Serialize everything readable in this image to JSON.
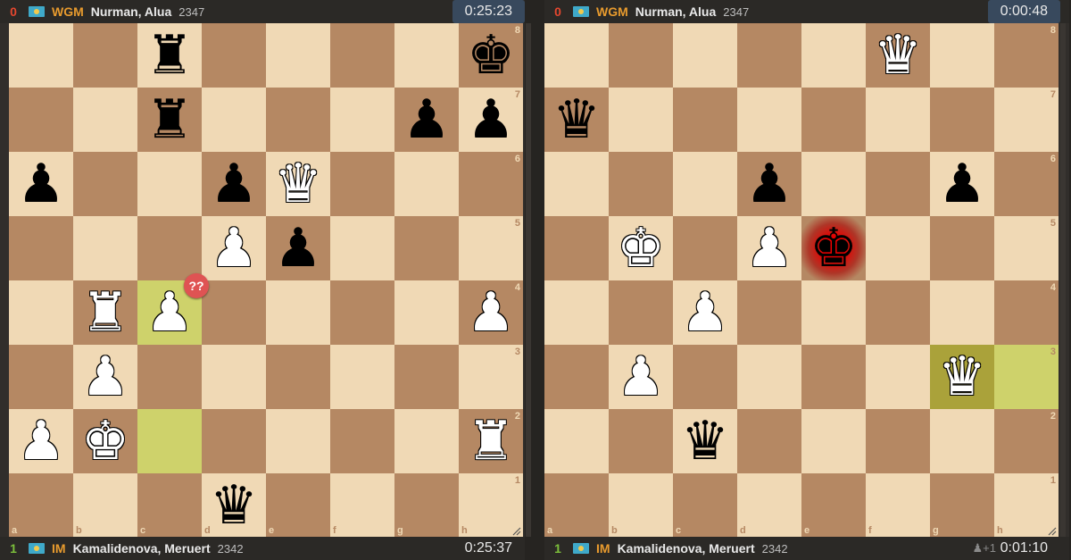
{
  "boards": [
    {
      "top": {
        "score": "0",
        "title": "WGM",
        "name": "Nurman, Alua",
        "rating": "2347",
        "clock": "0:25:23",
        "clock_active": true
      },
      "bottom": {
        "score": "1",
        "title": "IM",
        "name": "Kamalidenova, Meruert",
        "rating": "2342",
        "clock": "0:25:37",
        "clock_active": false,
        "extra": ""
      },
      "highlights": [
        "c4",
        "c2"
      ],
      "check": "",
      "annotation": {
        "square": "c4",
        "text": "??",
        "color": "#df5353"
      },
      "pieces": [
        {
          "sq": "c8",
          "type": "rook",
          "color": "black"
        },
        {
          "sq": "h8",
          "type": "king",
          "color": "black"
        },
        {
          "sq": "c7",
          "type": "rook",
          "color": "black"
        },
        {
          "sq": "g7",
          "type": "pawn",
          "color": "black"
        },
        {
          "sq": "h7",
          "type": "pawn",
          "color": "black"
        },
        {
          "sq": "a6",
          "type": "pawn",
          "color": "black"
        },
        {
          "sq": "d6",
          "type": "pawn",
          "color": "black"
        },
        {
          "sq": "e6",
          "type": "queen",
          "color": "white"
        },
        {
          "sq": "d5",
          "type": "pawn",
          "color": "white"
        },
        {
          "sq": "e5",
          "type": "pawn",
          "color": "black"
        },
        {
          "sq": "b4",
          "type": "rook",
          "color": "white"
        },
        {
          "sq": "c4",
          "type": "pawn",
          "color": "white"
        },
        {
          "sq": "h4",
          "type": "pawn",
          "color": "white"
        },
        {
          "sq": "b3",
          "type": "pawn",
          "color": "white"
        },
        {
          "sq": "a2",
          "type": "pawn",
          "color": "white"
        },
        {
          "sq": "b2",
          "type": "king",
          "color": "white"
        },
        {
          "sq": "h2",
          "type": "rook",
          "color": "white"
        },
        {
          "sq": "d1",
          "type": "queen",
          "color": "black"
        }
      ]
    },
    {
      "top": {
        "score": "0",
        "title": "WGM",
        "name": "Nurman, Alua",
        "rating": "2347",
        "clock": "0:00:48",
        "clock_active": true
      },
      "bottom": {
        "score": "1",
        "title": "IM",
        "name": "Kamalidenova, Meruert",
        "rating": "2342",
        "clock": "0:01:10",
        "clock_active": false,
        "extra": "♟+1"
      },
      "highlights": [
        "g3",
        "h3"
      ],
      "check": "e5",
      "annotation": null,
      "pieces": [
        {
          "sq": "f8",
          "type": "queen",
          "color": "white"
        },
        {
          "sq": "a7",
          "type": "queen",
          "color": "black"
        },
        {
          "sq": "d6",
          "type": "pawn",
          "color": "black"
        },
        {
          "sq": "g6",
          "type": "pawn",
          "color": "black"
        },
        {
          "sq": "b5",
          "type": "king",
          "color": "white"
        },
        {
          "sq": "d5",
          "type": "pawn",
          "color": "white"
        },
        {
          "sq": "e5",
          "type": "king",
          "color": "black"
        },
        {
          "sq": "c4",
          "type": "pawn",
          "color": "white"
        },
        {
          "sq": "b3",
          "type": "pawn",
          "color": "white"
        },
        {
          "sq": "g3",
          "type": "queen",
          "color": "white"
        },
        {
          "sq": "c2",
          "type": "queen",
          "color": "black"
        }
      ]
    }
  ],
  "files": [
    "a",
    "b",
    "c",
    "d",
    "e",
    "f",
    "g",
    "h"
  ],
  "ranks": [
    "8",
    "7",
    "6",
    "5",
    "4",
    "3",
    "2",
    "1"
  ],
  "colors": {
    "light": "#f0d9b5",
    "dark": "#b58863",
    "highlight_light": "#ced26b",
    "highlight_dark": "#aaa23a",
    "active_clock": "#38495d"
  }
}
